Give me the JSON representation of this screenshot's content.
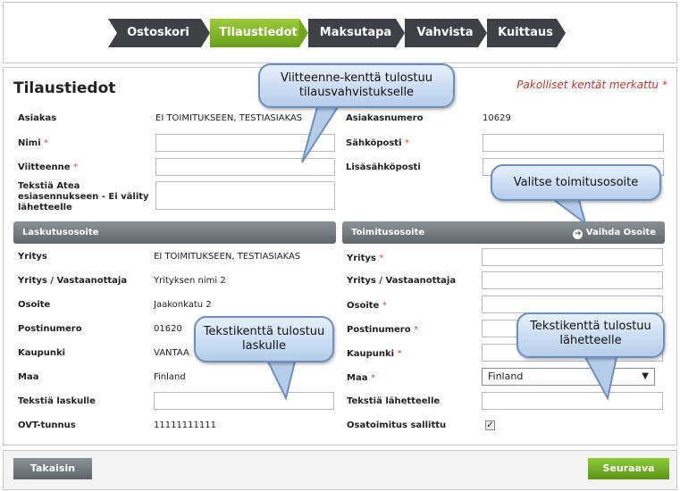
{
  "steps": [
    "Ostoskori",
    "Tilaustiedot",
    "Maksutapa",
    "Vahvista",
    "Kuittaus"
  ],
  "active_step": "Tilaustiedot",
  "page_title": "Tilaustiedot",
  "required_note": "Pakolliset kentät merkattu",
  "required_mark": "*",
  "customer": {
    "asiakas_label": "Asiakas",
    "asiakas_value": "EI TOIMITUKSEEN, TESTIASIAKAS",
    "asiakasnumero_label": "Asiakasnumero",
    "asiakasnumero_value": "10629",
    "nimi_label": "Nimi",
    "sahkoposti_label": "Sähköposti",
    "viitteenne_label": "Viitteenne",
    "lisasahkoposti_label": "Lisäsähköposti",
    "teksti_atea_label_1": "Tekstiä Atea",
    "teksti_atea_label_2": "esiasennukseen - Ei välity",
    "teksti_atea_label_3": "lähetteelle"
  },
  "billing": {
    "header": "Laskutusosoite",
    "yritys_label": "Yritys",
    "yritys_value": "EI TOIMITUKSEEN, TESTIASIAKAS",
    "vastaanottaja_label": "Yritys / Vastaanottaja",
    "vastaanottaja_value": "Yrityksen nimi 2",
    "osoite_label": "Osoite",
    "osoite_value": "Jaakonkatu 2",
    "postinumero_label": "Postinumero",
    "postinumero_value": "01620",
    "kaupunki_label": "Kaupunki",
    "kaupunki_value": "VANTAA",
    "maa_label": "Maa",
    "maa_value": "Finland",
    "teksti_laskulle_label": "Tekstiä laskulle",
    "ovt_label": "OVT-tunnus",
    "ovt_value": "11111111111"
  },
  "delivery": {
    "header": "Toimitusosoite",
    "change_address": "Vaihda Osoite",
    "yritys_label": "Yritys",
    "vastaanottaja_label": "Yritys / Vastaanottaja",
    "osoite_label": "Osoite",
    "postinumero_label": "Postinumero",
    "kaupunki_label": "Kaupunki",
    "maa_label": "Maa",
    "maa_value": "Finland",
    "teksti_lahetteelle_label": "Tekstiä lähetteelle",
    "osatoimitus_label": "Osatoimitus sallittu",
    "osatoimitus_checked": "✓"
  },
  "buttons": {
    "back": "Takaisin",
    "next": "Seuraava"
  },
  "callouts": {
    "viitteenne_1": "Viitteenne-kenttä tulostuu",
    "viitteenne_2": "tilausvahvistukselle",
    "toimitusosoite": "Valitse toimitusosoite",
    "laskulle_1": "Tekstikenttä tulostuu",
    "laskulle_2": "laskulle",
    "lahetteelle_1": "Tekstikenttä tulostuu",
    "lahetteelle_2": "lähetteelle"
  },
  "colors": {
    "accent_green": "#7ab62a",
    "step_dark": "#3e4145",
    "required_red": "#c0392b",
    "callout_border": "#6c8fc0"
  }
}
